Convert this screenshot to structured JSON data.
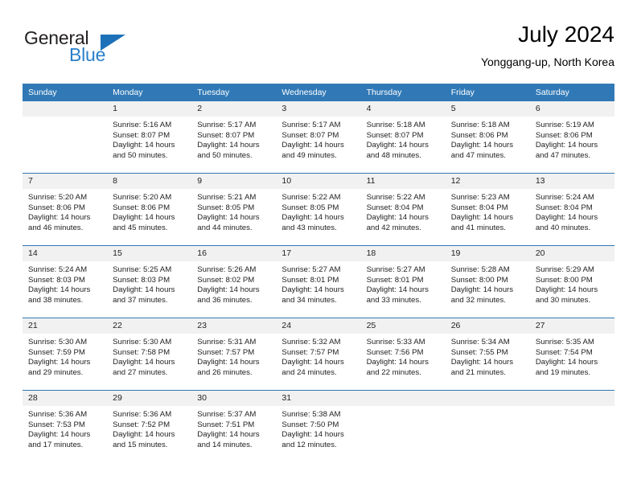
{
  "brand": {
    "name_part1": "General",
    "name_part2": "Blue",
    "accent_color": "#2a7fc9",
    "triangle_icon": "triangle-icon"
  },
  "header": {
    "title": "July 2024",
    "subtitle": "Yonggang-up, North Korea"
  },
  "calendar": {
    "header_bg": "#3179b6",
    "daynum_bg": "#f1f1f1",
    "weekdays": [
      "Sunday",
      "Monday",
      "Tuesday",
      "Wednesday",
      "Thursday",
      "Friday",
      "Saturday"
    ],
    "weeks": [
      [
        {
          "day": "",
          "lines": []
        },
        {
          "day": "1",
          "lines": [
            "Sunrise: 5:16 AM",
            "Sunset: 8:07 PM",
            "Daylight: 14 hours",
            "and 50 minutes."
          ]
        },
        {
          "day": "2",
          "lines": [
            "Sunrise: 5:17 AM",
            "Sunset: 8:07 PM",
            "Daylight: 14 hours",
            "and 50 minutes."
          ]
        },
        {
          "day": "3",
          "lines": [
            "Sunrise: 5:17 AM",
            "Sunset: 8:07 PM",
            "Daylight: 14 hours",
            "and 49 minutes."
          ]
        },
        {
          "day": "4",
          "lines": [
            "Sunrise: 5:18 AM",
            "Sunset: 8:07 PM",
            "Daylight: 14 hours",
            "and 48 minutes."
          ]
        },
        {
          "day": "5",
          "lines": [
            "Sunrise: 5:18 AM",
            "Sunset: 8:06 PM",
            "Daylight: 14 hours",
            "and 47 minutes."
          ]
        },
        {
          "day": "6",
          "lines": [
            "Sunrise: 5:19 AM",
            "Sunset: 8:06 PM",
            "Daylight: 14 hours",
            "and 47 minutes."
          ]
        }
      ],
      [
        {
          "day": "7",
          "lines": [
            "Sunrise: 5:20 AM",
            "Sunset: 8:06 PM",
            "Daylight: 14 hours",
            "and 46 minutes."
          ]
        },
        {
          "day": "8",
          "lines": [
            "Sunrise: 5:20 AM",
            "Sunset: 8:06 PM",
            "Daylight: 14 hours",
            "and 45 minutes."
          ]
        },
        {
          "day": "9",
          "lines": [
            "Sunrise: 5:21 AM",
            "Sunset: 8:05 PM",
            "Daylight: 14 hours",
            "and 44 minutes."
          ]
        },
        {
          "day": "10",
          "lines": [
            "Sunrise: 5:22 AM",
            "Sunset: 8:05 PM",
            "Daylight: 14 hours",
            "and 43 minutes."
          ]
        },
        {
          "day": "11",
          "lines": [
            "Sunrise: 5:22 AM",
            "Sunset: 8:04 PM",
            "Daylight: 14 hours",
            "and 42 minutes."
          ]
        },
        {
          "day": "12",
          "lines": [
            "Sunrise: 5:23 AM",
            "Sunset: 8:04 PM",
            "Daylight: 14 hours",
            "and 41 minutes."
          ]
        },
        {
          "day": "13",
          "lines": [
            "Sunrise: 5:24 AM",
            "Sunset: 8:04 PM",
            "Daylight: 14 hours",
            "and 40 minutes."
          ]
        }
      ],
      [
        {
          "day": "14",
          "lines": [
            "Sunrise: 5:24 AM",
            "Sunset: 8:03 PM",
            "Daylight: 14 hours",
            "and 38 minutes."
          ]
        },
        {
          "day": "15",
          "lines": [
            "Sunrise: 5:25 AM",
            "Sunset: 8:03 PM",
            "Daylight: 14 hours",
            "and 37 minutes."
          ]
        },
        {
          "day": "16",
          "lines": [
            "Sunrise: 5:26 AM",
            "Sunset: 8:02 PM",
            "Daylight: 14 hours",
            "and 36 minutes."
          ]
        },
        {
          "day": "17",
          "lines": [
            "Sunrise: 5:27 AM",
            "Sunset: 8:01 PM",
            "Daylight: 14 hours",
            "and 34 minutes."
          ]
        },
        {
          "day": "18",
          "lines": [
            "Sunrise: 5:27 AM",
            "Sunset: 8:01 PM",
            "Daylight: 14 hours",
            "and 33 minutes."
          ]
        },
        {
          "day": "19",
          "lines": [
            "Sunrise: 5:28 AM",
            "Sunset: 8:00 PM",
            "Daylight: 14 hours",
            "and 32 minutes."
          ]
        },
        {
          "day": "20",
          "lines": [
            "Sunrise: 5:29 AM",
            "Sunset: 8:00 PM",
            "Daylight: 14 hours",
            "and 30 minutes."
          ]
        }
      ],
      [
        {
          "day": "21",
          "lines": [
            "Sunrise: 5:30 AM",
            "Sunset: 7:59 PM",
            "Daylight: 14 hours",
            "and 29 minutes."
          ]
        },
        {
          "day": "22",
          "lines": [
            "Sunrise: 5:30 AM",
            "Sunset: 7:58 PM",
            "Daylight: 14 hours",
            "and 27 minutes."
          ]
        },
        {
          "day": "23",
          "lines": [
            "Sunrise: 5:31 AM",
            "Sunset: 7:57 PM",
            "Daylight: 14 hours",
            "and 26 minutes."
          ]
        },
        {
          "day": "24",
          "lines": [
            "Sunrise: 5:32 AM",
            "Sunset: 7:57 PM",
            "Daylight: 14 hours",
            "and 24 minutes."
          ]
        },
        {
          "day": "25",
          "lines": [
            "Sunrise: 5:33 AM",
            "Sunset: 7:56 PM",
            "Daylight: 14 hours",
            "and 22 minutes."
          ]
        },
        {
          "day": "26",
          "lines": [
            "Sunrise: 5:34 AM",
            "Sunset: 7:55 PM",
            "Daylight: 14 hours",
            "and 21 minutes."
          ]
        },
        {
          "day": "27",
          "lines": [
            "Sunrise: 5:35 AM",
            "Sunset: 7:54 PM",
            "Daylight: 14 hours",
            "and 19 minutes."
          ]
        }
      ],
      [
        {
          "day": "28",
          "lines": [
            "Sunrise: 5:36 AM",
            "Sunset: 7:53 PM",
            "Daylight: 14 hours",
            "and 17 minutes."
          ]
        },
        {
          "day": "29",
          "lines": [
            "Sunrise: 5:36 AM",
            "Sunset: 7:52 PM",
            "Daylight: 14 hours",
            "and 15 minutes."
          ]
        },
        {
          "day": "30",
          "lines": [
            "Sunrise: 5:37 AM",
            "Sunset: 7:51 PM",
            "Daylight: 14 hours",
            "and 14 minutes."
          ]
        },
        {
          "day": "31",
          "lines": [
            "Sunrise: 5:38 AM",
            "Sunset: 7:50 PM",
            "Daylight: 14 hours",
            "and 12 minutes."
          ]
        },
        {
          "day": "",
          "lines": []
        },
        {
          "day": "",
          "lines": []
        },
        {
          "day": "",
          "lines": []
        }
      ]
    ]
  }
}
